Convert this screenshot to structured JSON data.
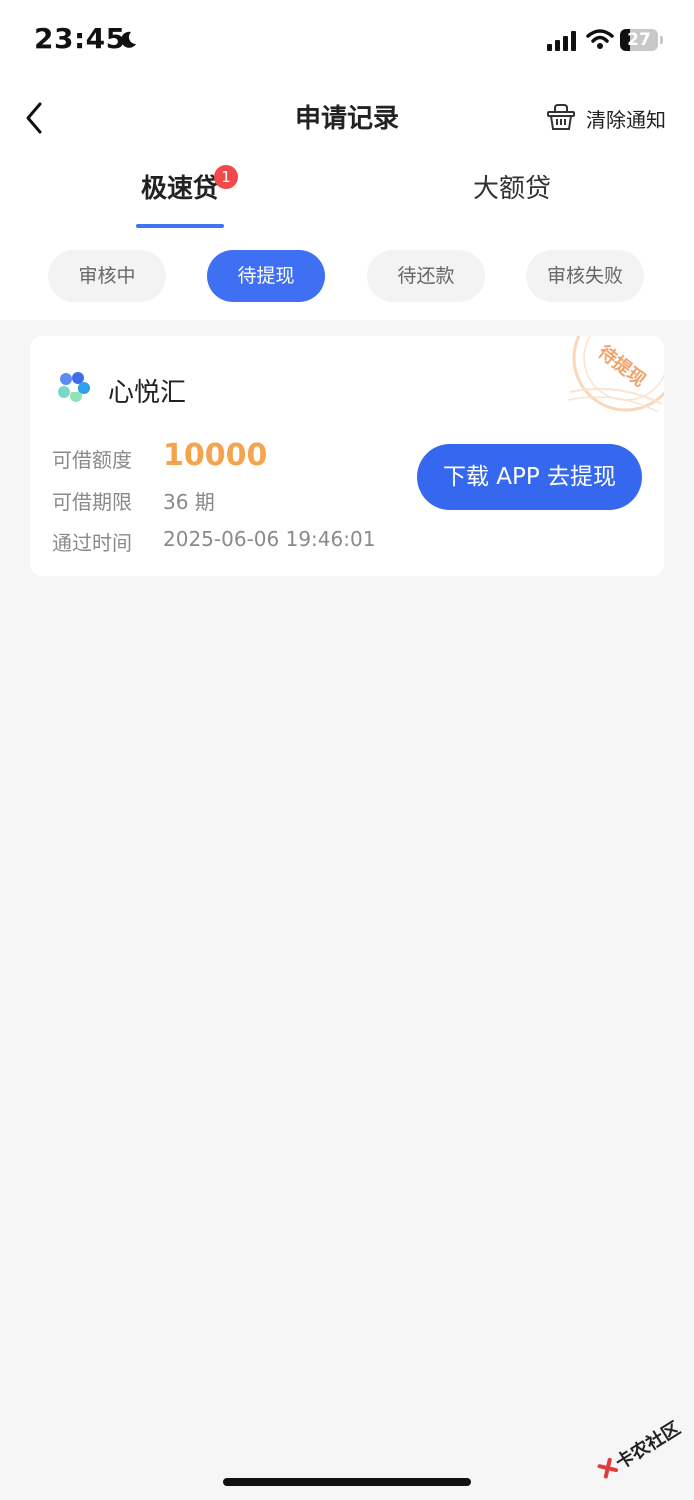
{
  "status_bar": {
    "time": "23:45",
    "battery_level": "27",
    "icons": [
      "moon-icon",
      "signal-icon",
      "wifi-icon",
      "battery-icon"
    ]
  },
  "nav": {
    "title": "申请记录",
    "clear_label": "清除通知",
    "back_icon": "chevron-left-icon",
    "clear_icon": "basket-icon"
  },
  "tabs": [
    {
      "label": "极速贷",
      "badge": "1",
      "active": true
    },
    {
      "label": "大额贷",
      "active": false
    }
  ],
  "filters": [
    {
      "label": "审核中",
      "active": false
    },
    {
      "label": "待提现",
      "active": true
    },
    {
      "label": "待还款",
      "active": false
    },
    {
      "label": "审核失败",
      "active": false
    }
  ],
  "card": {
    "brand": "心悦汇",
    "stamp": "待提现",
    "rows": [
      {
        "label": "可借额度",
        "value": "10000"
      },
      {
        "label": "可借期限",
        "value": "36 期"
      },
      {
        "label": "通过时间",
        "value": "2025-06-06 19:46:01"
      }
    ],
    "cta": "下载 APP 去提现"
  },
  "watermark": "卡农社区",
  "colors": {
    "accent": "#3f6ff2",
    "amount": "#f5a34c",
    "badge": "#f24a4a",
    "background": "#f6f6f6"
  }
}
